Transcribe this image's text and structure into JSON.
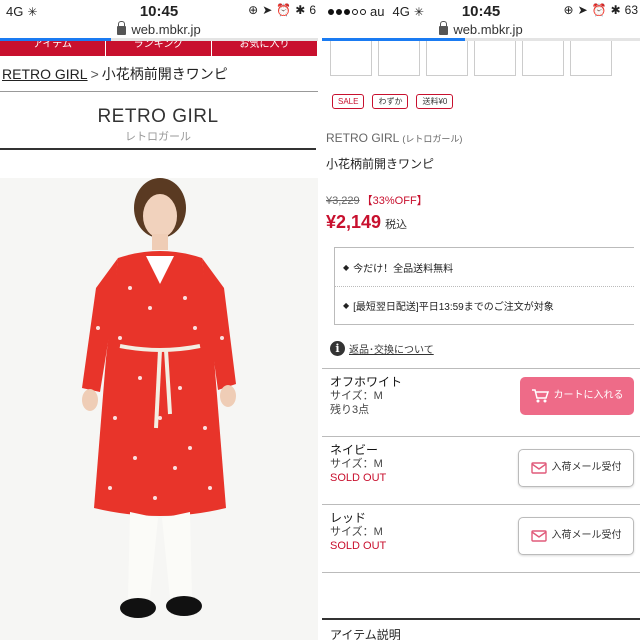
{
  "left": {
    "status": {
      "network": "4G",
      "time": "10:45",
      "battery": "6"
    },
    "url": "web.mbkr.jp",
    "progress_fraction": 0.35,
    "nav_tabs": [
      "アイテム",
      "ランキング",
      "お気に入り"
    ],
    "breadcrumb": {
      "brand": "RETRO GIRL",
      "separator": ">",
      "product": "小花柄前開きワンピ"
    },
    "brand": {
      "name": "RETRO GIRL",
      "kana": "レトロガール"
    },
    "photo_alt": "model wearing red floral dress"
  },
  "right": {
    "status": {
      "carrier": "au",
      "network": "4G",
      "time": "10:45",
      "battery": "63"
    },
    "url": "web.mbkr.jp",
    "progress_fraction": 0.45,
    "tags": [
      "SALE",
      "わずか",
      "送料¥0"
    ],
    "brand": {
      "name": "RETRO GIRL",
      "kana": "(レトロガール)"
    },
    "product_name": "小花柄前開きワンピ",
    "price": {
      "old": "¥3,229",
      "discount": "【33%OFF】",
      "current": "¥2,149",
      "tax": "税込"
    },
    "notices": [
      "今だけ！全品送料無料",
      "[最短翌日配送]平日13:59までのご注文が対象"
    ],
    "returns_link": "返品･交換について",
    "variants": [
      {
        "color": "オフホワイト",
        "size": "サイズ：M",
        "stock": "残り3点",
        "button": "カートに入れる",
        "button_type": "cart"
      },
      {
        "color": "ネイビー",
        "size": "サイズ：M",
        "stock": "SOLD OUT",
        "button": "入荷メール受付",
        "button_type": "mail"
      },
      {
        "color": "レッド",
        "size": "サイズ：M",
        "stock": "SOLD OUT",
        "button": "入荷メール受付",
        "button_type": "mail"
      }
    ],
    "section_title": "アイテム説明"
  },
  "colors": {
    "accent_red": "#c8102e",
    "cart_pink": "#ee6b88",
    "progress_blue": "#1a7bf2"
  }
}
